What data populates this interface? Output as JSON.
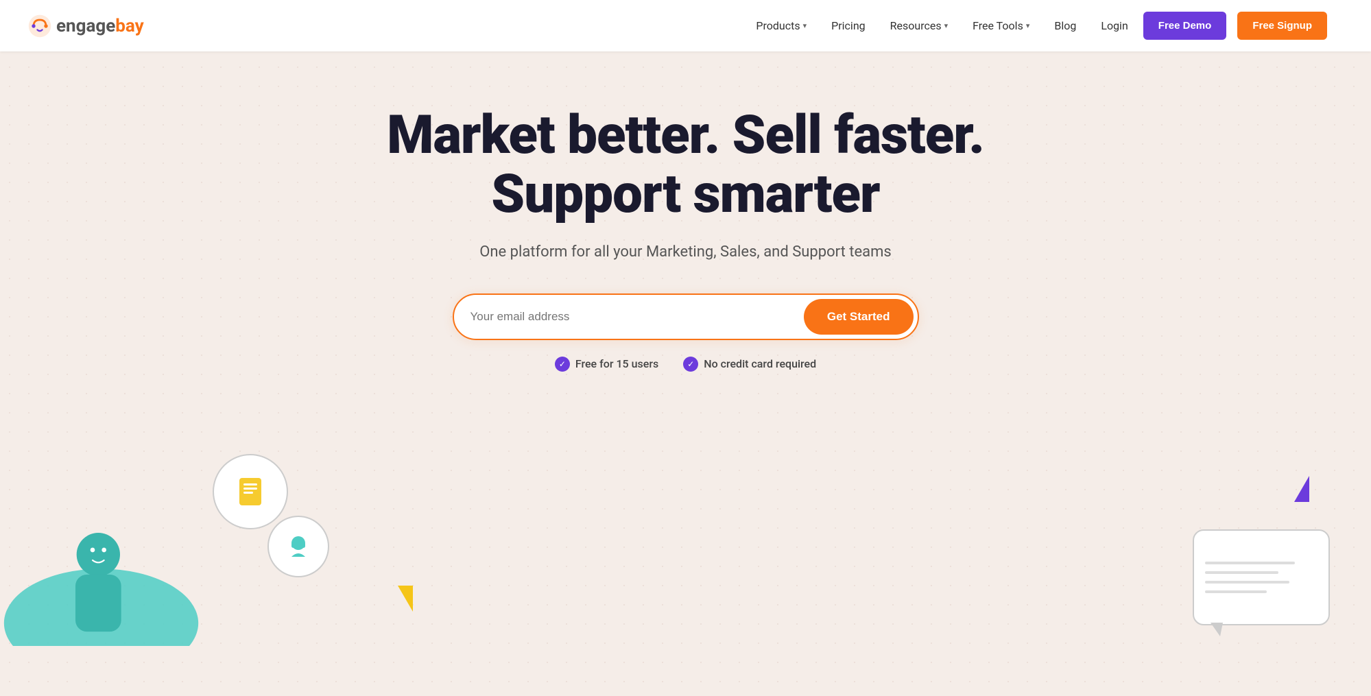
{
  "brand": {
    "name_part1": "engage",
    "name_part2": "bay",
    "logo_alt": "EngageBay logo"
  },
  "nav": {
    "items": [
      {
        "label": "Products",
        "has_dropdown": true
      },
      {
        "label": "Pricing",
        "has_dropdown": false
      },
      {
        "label": "Resources",
        "has_dropdown": true
      },
      {
        "label": "Free Tools",
        "has_dropdown": true
      },
      {
        "label": "Blog",
        "has_dropdown": false
      }
    ],
    "login_label": "Login",
    "free_demo_label": "Free Demo",
    "free_signup_label": "Free Signup"
  },
  "hero": {
    "title_line1": "Market better. Sell faster.",
    "title_line2": "Support smarter",
    "subtitle": "One platform for all your Marketing, Sales, and Support teams",
    "email_placeholder": "Your email address",
    "cta_label": "Get Started"
  },
  "trust": {
    "badge1": "Free for 15 users",
    "badge2": "No credit card required"
  },
  "colors": {
    "orange": "#f97316",
    "purple": "#6c3bdc",
    "teal": "#4ecdc4",
    "yellow": "#f5c518",
    "dark_text": "#1a1a2e",
    "body_bg": "#f5ede8"
  }
}
